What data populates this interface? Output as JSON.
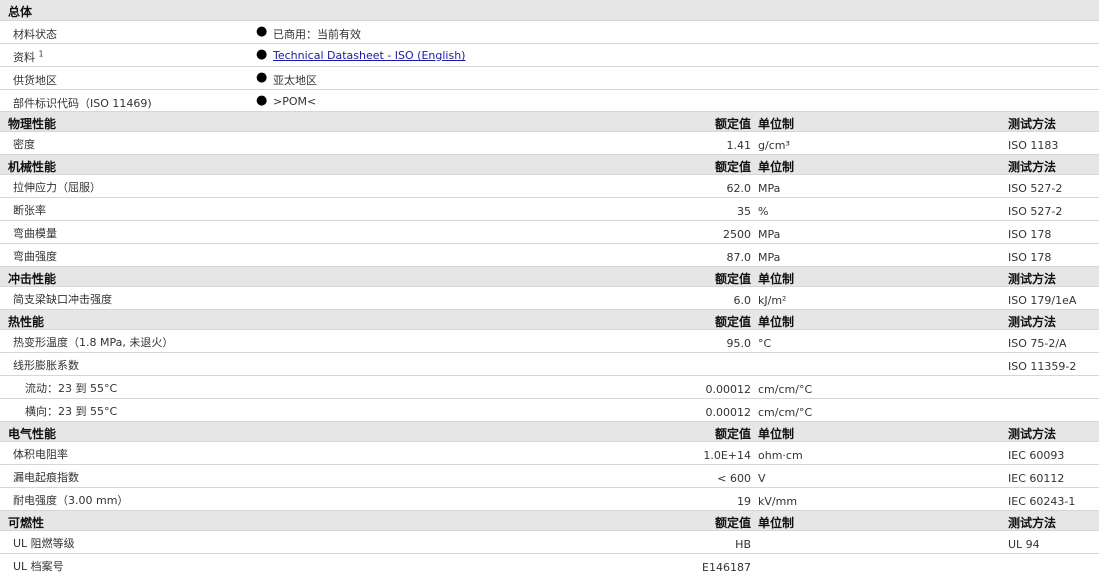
{
  "general": {
    "title": "总体",
    "rows": [
      {
        "label": "材料状态",
        "value": "已商用：当前有效"
      },
      {
        "label": "资料",
        "sup": "1",
        "value": "Technical Datasheet - ISO (English)"
      },
      {
        "label": "供货地区",
        "value": "亚太地区"
      },
      {
        "label": "部件标识代码（ISO 11469)",
        "value": ">POM<"
      }
    ]
  },
  "col_headers": {
    "value": "额定值",
    "unit": "单位制",
    "method": "测试方法"
  },
  "physical": {
    "title": "物理性能",
    "rows": [
      {
        "label": "密度",
        "value": "1.41",
        "unit": "g/cm³",
        "method": "ISO 1183"
      }
    ]
  },
  "mechanical": {
    "title": "机械性能",
    "rows": [
      {
        "label": "拉伸应力（屈服）",
        "value": "62.0",
        "unit": "MPa",
        "method": "ISO 527-2"
      },
      {
        "label": "断张率",
        "value": "35",
        "unit": "%",
        "method": "ISO 527-2"
      },
      {
        "label": "弯曲模量",
        "value": "2500",
        "unit": "MPa",
        "method": "ISO 178"
      },
      {
        "label": "弯曲强度",
        "value": "87.0",
        "unit": "MPa",
        "method": "ISO 178"
      }
    ]
  },
  "impact": {
    "title": "冲击性能",
    "rows": [
      {
        "label": "简支梁缺口冲击强度",
        "value": "6.0",
        "unit": "kJ/m²",
        "method": "ISO 179/1eA"
      }
    ]
  },
  "thermal": {
    "title": "热性能",
    "rows": [
      {
        "label": "热变形温度（1.8 MPa, 未退火）",
        "value": "95.0",
        "unit": "°C",
        "method": "ISO 75-2/A"
      },
      {
        "label": "线形膨胀系数",
        "value": "",
        "unit": "",
        "method": "ISO 11359-2"
      },
      {
        "label": "流动：23 到 55°C",
        "value": "0.00012",
        "unit": "cm/cm/°C",
        "method": ""
      },
      {
        "label": "横向：23 到 55°C",
        "value": "0.00012",
        "unit": "cm/cm/°C",
        "method": ""
      }
    ]
  },
  "electrical": {
    "title": "电气性能",
    "rows": [
      {
        "label": "体积电阻率",
        "value": "1.0E+14",
        "unit": "ohm·cm",
        "method": "IEC 60093"
      },
      {
        "label": "漏电起痕指数",
        "value": "< 600",
        "unit": "V",
        "method": "IEC 60112"
      },
      {
        "label": "耐电强度（3.00 mm）",
        "value": "19",
        "unit": "kV/mm",
        "method": "IEC 60243-1"
      }
    ]
  },
  "flammability": {
    "title": "可燃性",
    "rows": [
      {
        "label": "UL 阻燃等级",
        "value": "HB",
        "unit": "",
        "method": "UL 94"
      },
      {
        "label": "UL 档案号",
        "value": "E146187",
        "unit": "",
        "method": ""
      }
    ]
  }
}
